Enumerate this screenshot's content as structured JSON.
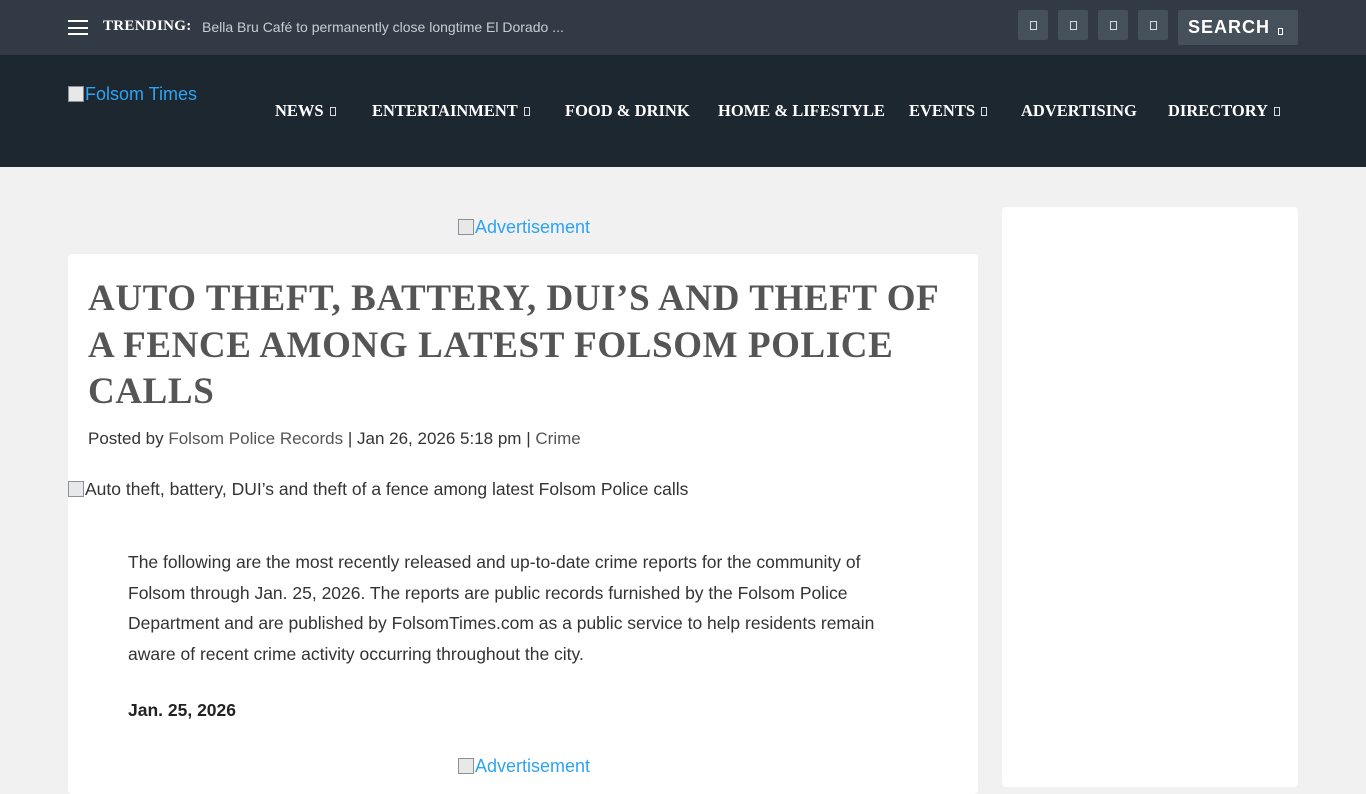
{
  "topbar": {
    "trending_label": "TRENDING:",
    "trending_text": "Bella Bru Café to permanently close longtime El Dorado ...",
    "social_icons": [
      "facebook-icon",
      "twitter-icon",
      "instagram-icon",
      "rss-icon"
    ],
    "search_label": "SEARCH"
  },
  "header": {
    "logo_alt": "Folsom Times",
    "nav": [
      {
        "label": "NEWS",
        "has_dropdown": true
      },
      {
        "label": "ENTERTAINMENT",
        "has_dropdown": true
      },
      {
        "label": "FOOD & DRINK",
        "has_dropdown": false
      },
      {
        "label": "HOME & LIFESTYLE",
        "has_dropdown": false
      },
      {
        "label": "EVENTS",
        "has_dropdown": true
      },
      {
        "label": "ADVERTISING",
        "has_dropdown": false
      },
      {
        "label": "DIRECTORY",
        "has_dropdown": true
      }
    ]
  },
  "ads": {
    "top_alt": "Advertisement",
    "bottom_alt": "Advertisement"
  },
  "article": {
    "title": "AUTO THEFT, BATTERY, DUI’S AND THEFT OF A FENCE AMONG LATEST FOLSOM POLICE CALLS",
    "posted_by": "Posted by",
    "author": "Folsom Police Records",
    "separator": "|",
    "date": "Jan 26, 2026 5:18 pm",
    "category": "Crime",
    "featured_image_alt": "Auto theft, battery, DUI’s and theft of a fence among latest Folsom Police calls",
    "intro": "The following are the most recently released and up-to-date crime reports for the community of Folsom through Jan. 25, 2026. The reports are public records furnished by the Folsom Police Department and are published by FolsomTimes.com as a public service to help residents remain aware of recent crime activity occurring throughout the city.",
    "section_date": "Jan. 25, 2026"
  },
  "colors": {
    "topbar_bg": "#323b45",
    "navbar_bg": "#1d2730",
    "link_blue": "#2ea3f2",
    "title_gray": "#555555"
  }
}
